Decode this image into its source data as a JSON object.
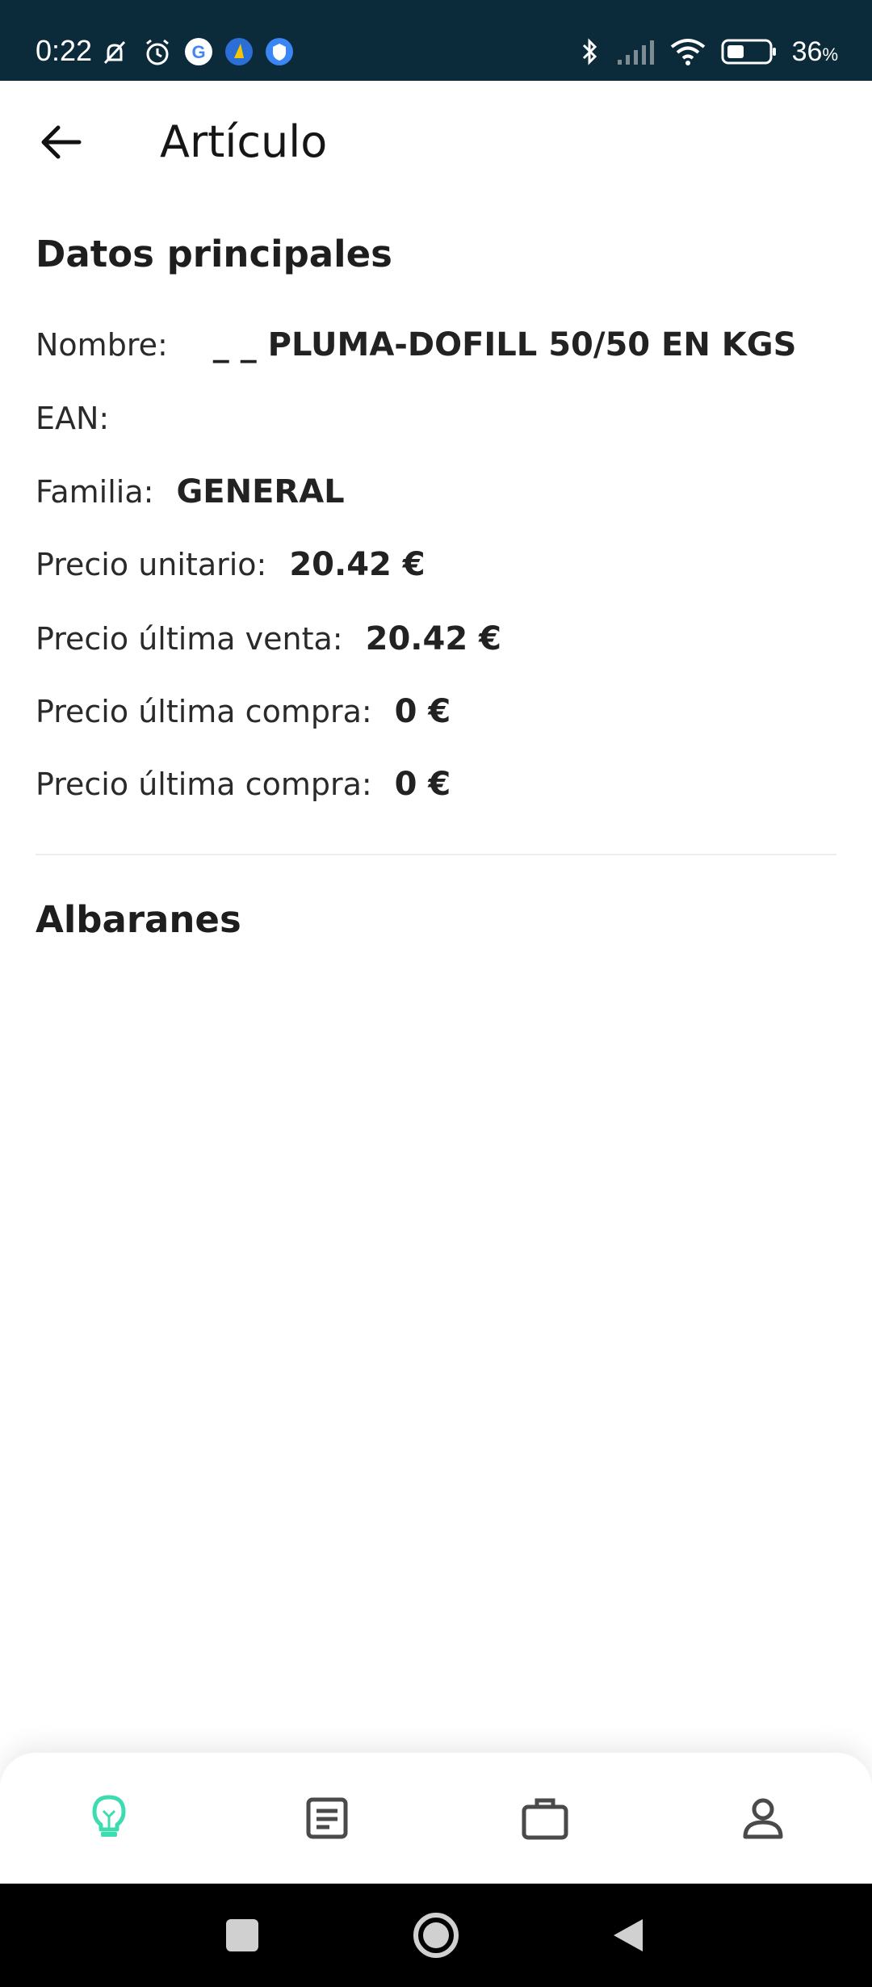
{
  "status_bar": {
    "time": "0:22",
    "battery_value": "36",
    "battery_unit": "%"
  },
  "header": {
    "title": "Artículo"
  },
  "main_data": {
    "section_title": "Datos principales",
    "fields": [
      {
        "label": "Nombre:",
        "value": "_ _ PLUMA-DOFILL 50/50 EN KGS"
      },
      {
        "label": "EAN:",
        "value": ""
      },
      {
        "label": "Familia:",
        "value": "GENERAL"
      },
      {
        "label": "Precio unitario:",
        "value": "20.42 €"
      },
      {
        "label": "Precio última venta:",
        "value": "20.42 €"
      },
      {
        "label": "Precio última compra:",
        "value": "0 €"
      },
      {
        "label": "Precio última compra:",
        "value": "0 €"
      }
    ]
  },
  "delivery_notes": {
    "section_title": "Albaranes"
  },
  "bottom_nav": {
    "items": [
      {
        "icon": "lightbulb-icon",
        "active": true
      },
      {
        "icon": "document-icon",
        "active": false
      },
      {
        "icon": "briefcase-icon",
        "active": false
      },
      {
        "icon": "user-icon",
        "active": false
      }
    ],
    "active_color": "#3ddbb0",
    "inactive_color": "#4a4a4a"
  }
}
